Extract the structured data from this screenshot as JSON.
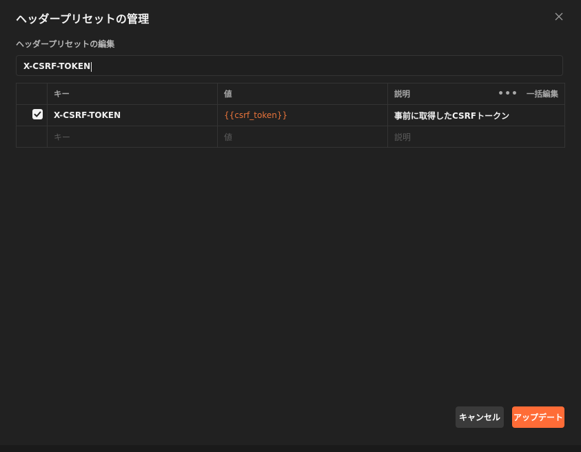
{
  "dialog": {
    "title": "ヘッダープリセットの管理",
    "subtitle": "ヘッダープリセットの編集",
    "preset_name": "X-CSRF-TOKEN"
  },
  "table": {
    "headers": {
      "key": "キー",
      "value": "値",
      "description": "説明",
      "bulk_edit": "一括編集"
    },
    "rows": [
      {
        "checked": true,
        "key": "X-CSRF-TOKEN",
        "value": "{{csrf_token}}",
        "description": "事前に取得したCSRFトークン"
      }
    ],
    "placeholders": {
      "key": "キー",
      "value": "値",
      "description": "説明"
    }
  },
  "footer": {
    "cancel_label": "キャンセル",
    "update_label": "アップデート"
  },
  "colors": {
    "accent": "#ff6c37",
    "variable": "#e8743b",
    "background": "#212121"
  },
  "icons": {
    "close": "close-icon",
    "more": "more-horizontal-icon",
    "check": "checkmark-icon"
  }
}
